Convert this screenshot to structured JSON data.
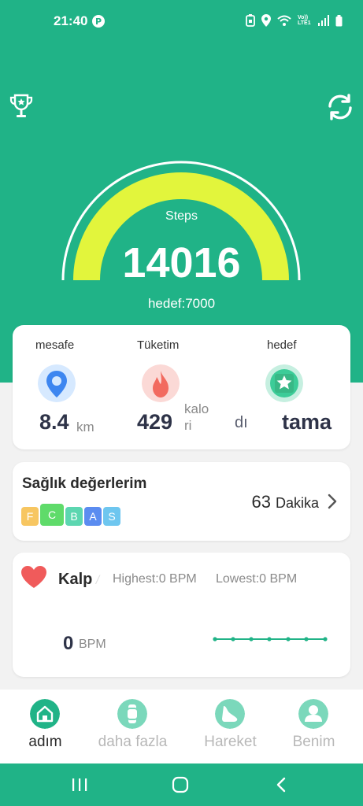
{
  "status_bar": {
    "time": "21:40",
    "carrier": "Vo)) LTE1",
    "icons": [
      "paypal-icon",
      "battery-saver-icon",
      "location-icon",
      "wifi-icon",
      "signal-icon",
      "battery-icon"
    ]
  },
  "header": {
    "steps_label": "Steps",
    "steps_value": "14016",
    "goal_label": "hedef:7000",
    "progress_fraction": 1.0,
    "icons": [
      "trophy-icon",
      "sync-icon"
    ]
  },
  "stats": {
    "distance": {
      "title": "mesafe",
      "value": "8.4",
      "unit": "km"
    },
    "calories": {
      "title": "Tüketim",
      "value": "429",
      "unit_line1": "kalo",
      "unit_line2": "ri"
    },
    "goal": {
      "title": "hedef",
      "value": "tama",
      "partial_unit": "dı"
    }
  },
  "health": {
    "title": "Sağlık değerlerim",
    "grades": [
      {
        "label": "F",
        "color": "#f7c661"
      },
      {
        "label": "C",
        "color": "#5fdb6a"
      },
      {
        "label": "B",
        "color": "#5cd6b0"
      },
      {
        "label": "A",
        "color": "#5b8cf0"
      },
      {
        "label": "S",
        "color": "#6ec6ef"
      }
    ],
    "minutes": "63",
    "minutes_unit": "Dakika"
  },
  "heart": {
    "title": "Kalp",
    "highest": "Highest:0  BPM",
    "lowest": "Lowest:0  BPM",
    "value": "0",
    "unit": "BPM"
  },
  "tabs": [
    {
      "label": "adım",
      "active": true
    },
    {
      "label": "daha fazla",
      "active": false
    },
    {
      "label": "Hareket",
      "active": false
    },
    {
      "label": "Benim",
      "active": false
    }
  ],
  "colors": {
    "brand": "#20b387",
    "gauge_fill": "#e2f53c",
    "tab_inactive": "#b8b8b8"
  }
}
